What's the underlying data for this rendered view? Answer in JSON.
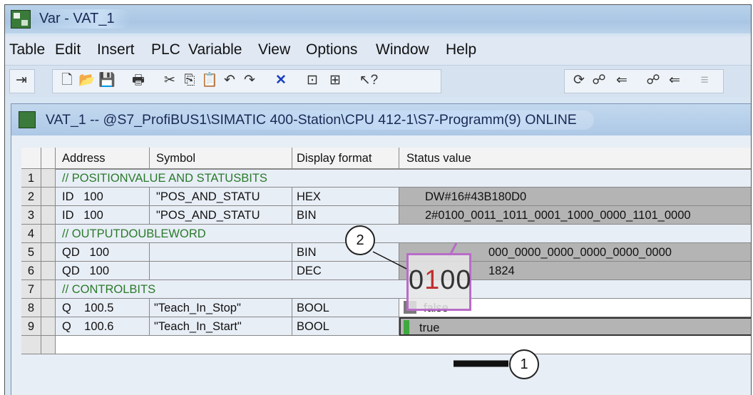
{
  "window": {
    "title": "Var - VAT_1"
  },
  "menu": [
    "Table",
    "Edit",
    "Insert",
    "PLC",
    "Variable",
    "View",
    "Options",
    "Window",
    "Help"
  ],
  "toolbar": {
    "icons": [
      "pin-icon",
      "new-icon",
      "open-icon",
      "save-icon",
      "print-icon",
      "cut-icon",
      "copy-icon",
      "paste-icon",
      "undo-icon",
      "redo-icon",
      "delete-icon",
      "monitor-icon",
      "modify-icon",
      "help-icon",
      "trigger-icon",
      "monitor-glasses-icon",
      "modify-arrow-icon",
      "monitor-once-icon",
      "modify-once-icon",
      "disabled-icon"
    ],
    "glyphs": [
      "⇥",
      "🗋",
      "📂",
      "💾",
      "🖶",
      "✂",
      "⎘",
      "📋",
      "↶",
      "↷",
      "✕",
      "⊡",
      "⊞",
      "↖?",
      "⟳",
      "☍",
      "⇐",
      "☍",
      "⇐",
      "≡"
    ]
  },
  "child": {
    "title": "VAT_1 -- @S7_ProfiBUS1\\SIMATIC 400-Station\\CPU 412-1\\S7-Programm(9)  ONLINE"
  },
  "table": {
    "headers": [
      "Address",
      "Symbol",
      "Display format",
      "Status value"
    ],
    "rows": [
      {
        "num": "1",
        "address": "// POSITIONVALUE AND STATUSBITS",
        "symbol": "",
        "format": "",
        "status": ""
      },
      {
        "num": "2",
        "address": "ID   100",
        "symbol": "\"POS_AND_STATU",
        "format": "HEX",
        "status": "DW#16#43B180D0"
      },
      {
        "num": "3",
        "address": "ID   100",
        "symbol": "\"POS_AND_STATU",
        "format": "BIN",
        "status": "2#0100_0011_1011_0001_1000_0000_1101_0000"
      },
      {
        "num": "4",
        "address": "// OUTPUTDOUBLEWORD",
        "symbol": "",
        "format": "",
        "status": ""
      },
      {
        "num": "5",
        "address": "QD   100",
        "symbol": "",
        "format": "BIN",
        "status": "000_0000_0000_0000_0000_0000"
      },
      {
        "num": "6",
        "address": "QD   100",
        "symbol": "",
        "format": "DEC",
        "status": "1824"
      },
      {
        "num": "7",
        "address": "// CONTROLBITS",
        "symbol": "",
        "format": "",
        "status": ""
      },
      {
        "num": "8",
        "address": "Q    100.5",
        "symbol": "\"Teach_In_Stop\"",
        "format": "BOOL",
        "status": "false"
      },
      {
        "num": "9",
        "address": "Q    100.6",
        "symbol": "\"Teach_In_Start\"",
        "format": "BOOL",
        "status": "true"
      }
    ]
  },
  "zoom": {
    "prefix": "0",
    "pink": "1",
    "suffix": "00"
  },
  "callouts": {
    "one": "1",
    "two": "2"
  }
}
